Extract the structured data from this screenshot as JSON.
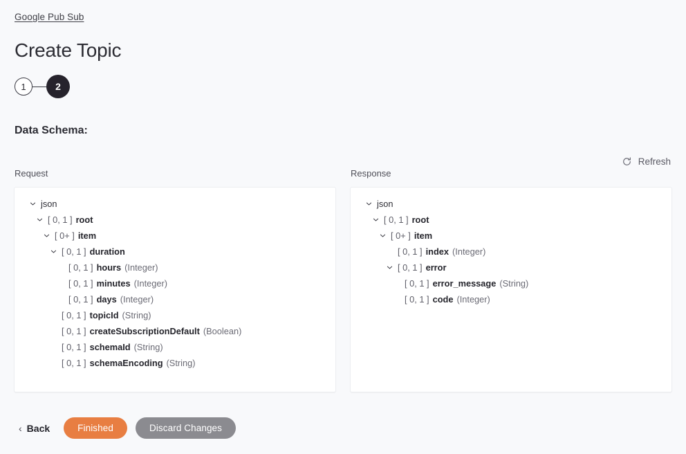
{
  "breadcrumb": {
    "label": "Google Pub Sub"
  },
  "header": {
    "title": "Create Topic"
  },
  "stepper": {
    "steps": [
      {
        "label": "1",
        "state": "inactive"
      },
      {
        "label": "2",
        "state": "active"
      }
    ]
  },
  "schema": {
    "heading": "Data Schema:",
    "refresh_label": "Refresh",
    "request": {
      "panel_label": "Request",
      "nodes": [
        {
          "depth": 0,
          "expanded": true,
          "cardinality": "",
          "name": "json",
          "type": "",
          "bold": false
        },
        {
          "depth": 1,
          "expanded": true,
          "cardinality": "[ 0, 1 ]",
          "name": "root",
          "type": "",
          "bold": true
        },
        {
          "depth": 2,
          "expanded": true,
          "cardinality": "[ 0+ ]",
          "name": "item",
          "type": "",
          "bold": true
        },
        {
          "depth": 3,
          "expanded": true,
          "cardinality": "[ 0, 1 ]",
          "name": "duration",
          "type": "",
          "bold": true
        },
        {
          "depth": 4,
          "expanded": null,
          "cardinality": "[ 0, 1 ]",
          "name": "hours",
          "type": "(Integer)",
          "bold": true
        },
        {
          "depth": 4,
          "expanded": null,
          "cardinality": "[ 0, 1 ]",
          "name": "minutes",
          "type": "(Integer)",
          "bold": true
        },
        {
          "depth": 4,
          "expanded": null,
          "cardinality": "[ 0, 1 ]",
          "name": "days",
          "type": "(Integer)",
          "bold": true
        },
        {
          "depth": 3,
          "expanded": null,
          "cardinality": "[ 0, 1 ]",
          "name": "topicId",
          "type": "(String)",
          "bold": true
        },
        {
          "depth": 3,
          "expanded": null,
          "cardinality": "[ 0, 1 ]",
          "name": "createSubscriptionDefault",
          "type": "(Boolean)",
          "bold": true
        },
        {
          "depth": 3,
          "expanded": null,
          "cardinality": "[ 0, 1 ]",
          "name": "schemaId",
          "type": "(String)",
          "bold": true
        },
        {
          "depth": 3,
          "expanded": null,
          "cardinality": "[ 0, 1 ]",
          "name": "schemaEncoding",
          "type": "(String)",
          "bold": true
        }
      ]
    },
    "response": {
      "panel_label": "Response",
      "nodes": [
        {
          "depth": 0,
          "expanded": true,
          "cardinality": "",
          "name": "json",
          "type": "",
          "bold": false
        },
        {
          "depth": 1,
          "expanded": true,
          "cardinality": "[ 0, 1 ]",
          "name": "root",
          "type": "",
          "bold": true
        },
        {
          "depth": 2,
          "expanded": true,
          "cardinality": "[ 0+ ]",
          "name": "item",
          "type": "",
          "bold": true
        },
        {
          "depth": 3,
          "expanded": null,
          "cardinality": "[ 0, 1 ]",
          "name": "index",
          "type": "(Integer)",
          "bold": true
        },
        {
          "depth": 3,
          "expanded": true,
          "cardinality": "[ 0, 1 ]",
          "name": "error",
          "type": "",
          "bold": true
        },
        {
          "depth": 4,
          "expanded": null,
          "cardinality": "[ 0, 1 ]",
          "name": "error_message",
          "type": "(String)",
          "bold": true
        },
        {
          "depth": 4,
          "expanded": null,
          "cardinality": "[ 0, 1 ]",
          "name": "code",
          "type": "(Integer)",
          "bold": true
        }
      ]
    }
  },
  "footer": {
    "back_label": "Back",
    "back_chevron": "‹",
    "finished_label": "Finished",
    "discard_label": "Discard Changes"
  },
  "colors": {
    "page_background": "#f8f9fb",
    "panel_background": "#ffffff",
    "panel_border": "#eceef1",
    "step_active": "#26232c",
    "primary_button": "#e87e42",
    "secondary_button": "#8b8b90",
    "text": "#2b2b30",
    "muted_text": "#6a6a74"
  }
}
